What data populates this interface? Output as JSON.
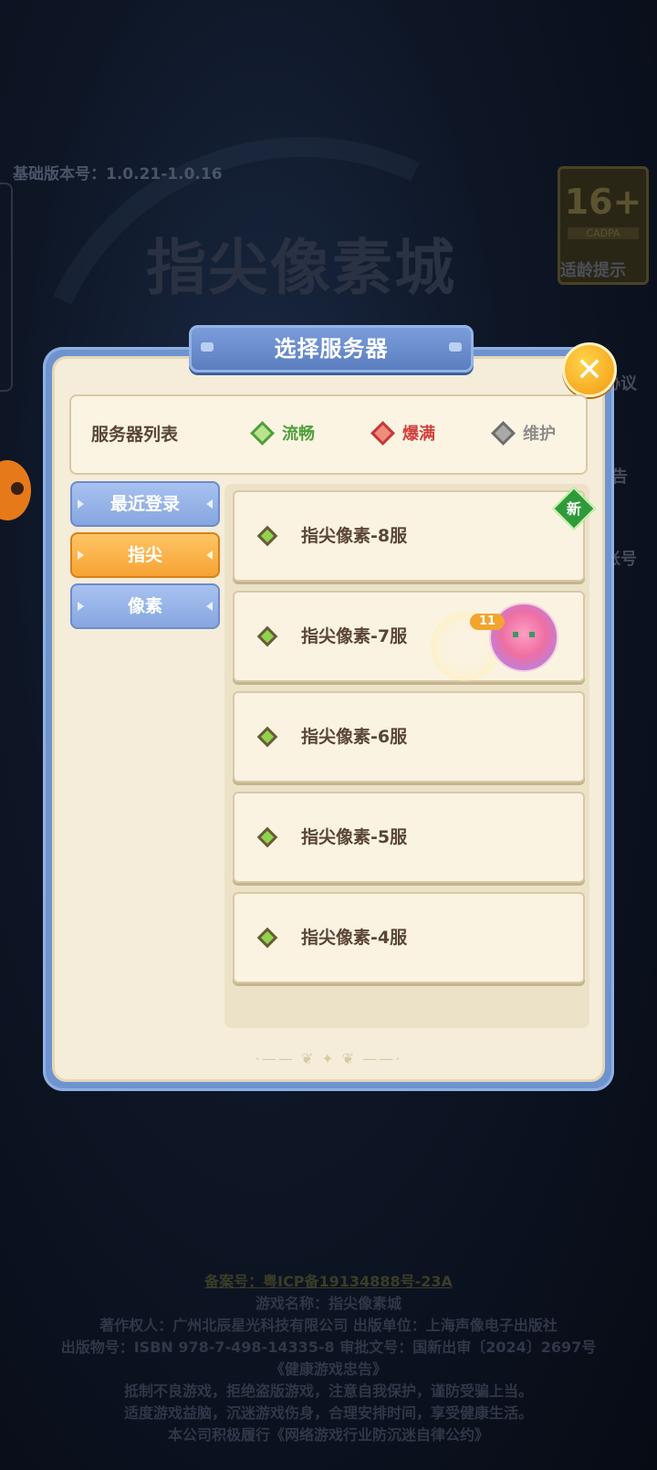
{
  "background": {
    "version_text": "基础版本号：1.0.21-1.0.16",
    "logo_text": "指尖像素城",
    "age_rating": {
      "number": "16+",
      "label": "CADPA",
      "tip": "适龄提示"
    },
    "side_labels": [
      "协议",
      "告",
      "账号"
    ],
    "footer_lines": [
      "备案号：粤ICP备19134888号-23A",
      "游戏名称：指尖像素城",
      "著作权人：广州北辰星光科技有限公司  出版单位：上海声像电子出版社",
      "出版物号：ISBN 978-7-498-14335-8  审批文号：国新出审〔2024〕2697号",
      "《健康游戏忠告》",
      "抵制不良游戏，拒绝盗版游戏，注意自我保护，谨防受骗上当。",
      "适度游戏益脑，沉迷游戏伤身，合理安排时间，享受健康生活。",
      "本公司积极履行《网络游戏行业防沉迷自律公约》"
    ]
  },
  "dialog": {
    "title": "选择服务器",
    "close_icon": "✕",
    "legend": {
      "title": "服务器列表",
      "items": [
        {
          "label": "流畅",
          "color": "#4f9f3a"
        },
        {
          "label": "爆满",
          "color": "#d2403c"
        },
        {
          "label": "维护",
          "color": "#8d8d8d"
        }
      ]
    },
    "tabs": [
      {
        "label": "最近登录"
      },
      {
        "label": "指尖"
      },
      {
        "label": "像素"
      }
    ],
    "new_badge": "新",
    "servers": [
      {
        "name": "指尖像素-8服"
      },
      {
        "name": "指尖像素-7服",
        "level": "11"
      },
      {
        "name": "指尖像素-6服"
      },
      {
        "name": "指尖像素-5服"
      },
      {
        "name": "指尖像素-4服"
      }
    ],
    "ornament": "·—— ❦ ✦ ❦ ——·"
  }
}
